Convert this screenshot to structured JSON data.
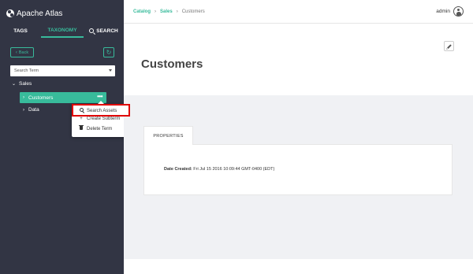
{
  "brand": {
    "name": "Apache Atlas"
  },
  "sidebar": {
    "tabs": [
      {
        "label": "TAGS"
      },
      {
        "label": "TAXONOMY"
      },
      {
        "label": "SEARCH"
      }
    ],
    "back_label": "Back",
    "search_placeholder": "Search Term",
    "tree": {
      "root": "Sales",
      "children": [
        {
          "label": "Customers",
          "selected": true
        },
        {
          "label": "Data",
          "selected": false
        }
      ]
    },
    "context_menu": [
      {
        "label": "Search Assets",
        "icon": "search-icon"
      },
      {
        "label": "Create Subterm",
        "icon": "plus-icon"
      },
      {
        "label": "Delete Term",
        "icon": "trash-icon"
      }
    ]
  },
  "header": {
    "breadcrumb": [
      "Catalog",
      "Sales",
      "Customers"
    ],
    "user": "admin"
  },
  "main": {
    "title": "Customers",
    "panel_tab": "PROPERTIES",
    "properties": [
      {
        "label": "Date Created:",
        "value": "Fri Jul 15 2016 10:09:44 GMT-0400 (EDT)"
      }
    ]
  },
  "colors": {
    "accent": "#38bb9b",
    "sidebar_bg": "#323544",
    "highlight": "#e00000",
    "content_bg": "#f0f1f4"
  }
}
